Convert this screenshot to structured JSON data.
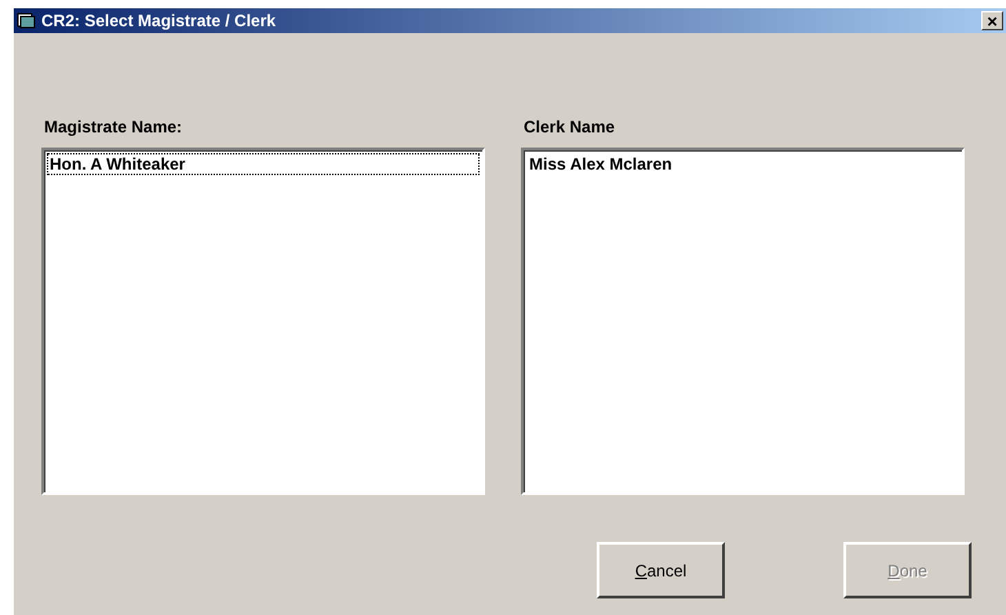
{
  "window": {
    "title": "CR2: Select Magistrate / Clerk",
    "close": "×"
  },
  "lists": [
    {
      "label": "Magistrate Name:",
      "items": [
        {
          "text": "Hon. A Whiteaker",
          "focused": true
        }
      ]
    },
    {
      "label": "Clerk Name",
      "items": [
        {
          "text": "Miss Alex Mclaren",
          "focused": false
        }
      ]
    }
  ],
  "buttons": [
    {
      "label": "Cancel",
      "disabled": false
    },
    {
      "label": "Done",
      "disabled": true
    }
  ]
}
